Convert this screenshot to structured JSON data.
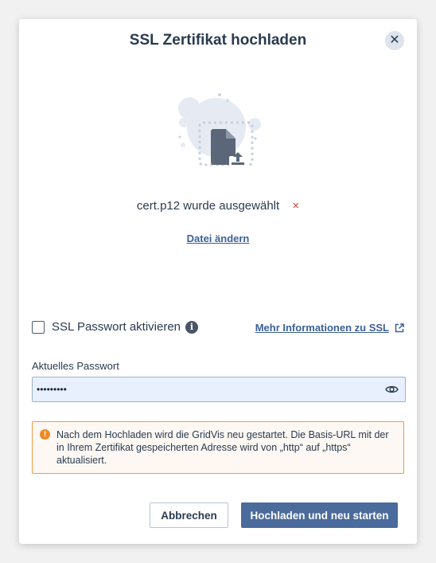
{
  "dialog": {
    "title": "SSL Zertifikat hochladen",
    "close_icon": "close-icon"
  },
  "upload": {
    "illustration_icon": "file-upload-icon",
    "selected_file_text": "cert.p12 wurde ausgewählt",
    "remove_icon": "×",
    "change_link": "Datei ändern"
  },
  "ssl_password": {
    "checkbox_label": "SSL Passwort aktivieren",
    "checkbox_checked": false,
    "info_icon": "i",
    "more_info_link": "Mehr Informationen zu SSL",
    "field_label": "Aktuelles Passwort",
    "field_value": "•••••••••",
    "eye_icon": "eye-icon"
  },
  "warning": {
    "icon": "!",
    "text": "Nach dem Hochladen wird die GridVis neu gestartet. Die Basis-URL mit der in Ihrem Zertifikat gespeicherten Adresse wird von „http“ auf „https“ aktualisiert."
  },
  "buttons": {
    "cancel": "Abbrechen",
    "primary": "Hochladen und neu starten"
  },
  "colors": {
    "accent": "#4a6b9c",
    "link": "#3c6195",
    "warning_border": "#ef9b47",
    "remove": "#d9442f"
  }
}
